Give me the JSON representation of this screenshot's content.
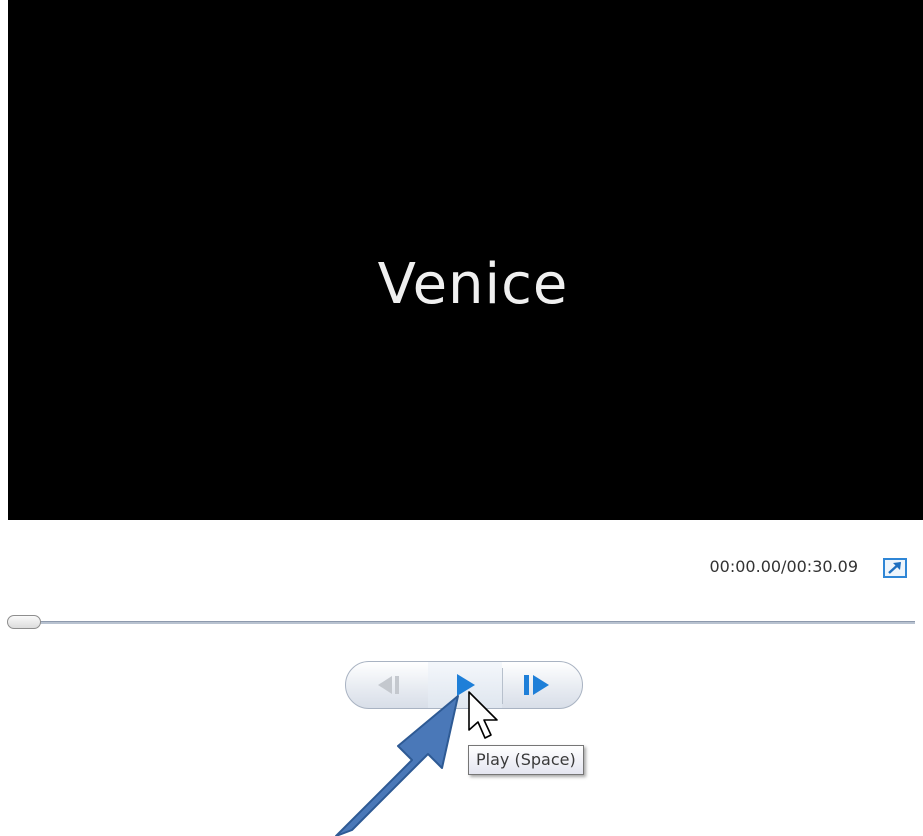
{
  "preview": {
    "title": "Venice"
  },
  "playback": {
    "time_readout": "00:00.00/00:30.09",
    "position_fraction": 0.0
  },
  "controls": {
    "previous_frame_icon": "previous-frame-icon",
    "play_icon": "play-icon",
    "next_frame_icon": "next-frame-icon",
    "fullscreen_icon": "fullscreen-icon"
  },
  "tooltip": {
    "text": "Play (Space)"
  },
  "colors": {
    "preview_background": "#000000",
    "accent_blue": "#1e7fd8",
    "callout_arrow": "#4a78b8"
  }
}
